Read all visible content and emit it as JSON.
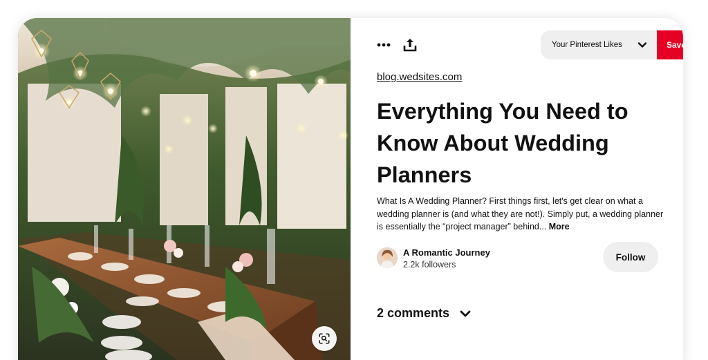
{
  "toolbar": {
    "more_icon": "ellipsis-icon",
    "share_icon": "share-upload-icon",
    "board_select_label": "Your Pinterest Likes",
    "board_select_icon": "chevron-down-icon",
    "save_label": "Save",
    "save_color": "#e60023"
  },
  "pin": {
    "source": "blog.wedsites.com",
    "title": "Everything You Need to Know About Wedding Planners",
    "description": "What Is A Wedding Planner? First things first, let's get clear on what a wedding planner is (and what they are not!). Simply put, a wedding planner is essentially the “project manager” behind...",
    "more_label": "More",
    "image_action_icon": "visual-search-icon"
  },
  "creator": {
    "name": "A Romantic Journey",
    "followers": "2.2k followers",
    "follow_label": "Follow"
  },
  "comments": {
    "label": "2 comments",
    "icon": "chevron-down-icon"
  }
}
